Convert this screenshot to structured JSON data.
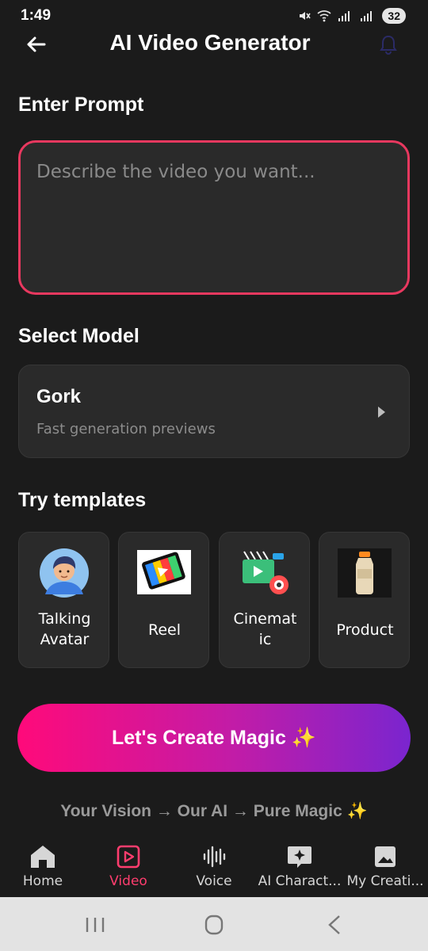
{
  "status": {
    "time": "1:49",
    "battery": "32"
  },
  "header": {
    "title": "AI Video Generator"
  },
  "prompt": {
    "section_title": "Enter Prompt",
    "placeholder": "Describe the video you want..."
  },
  "model": {
    "section_title": "Select Model",
    "name": "Gork",
    "description": "Fast generation previews"
  },
  "templates": {
    "section_title": "Try templates",
    "items": [
      {
        "line1": "Talking",
        "line2": "Avatar",
        "icon": "avatar-icon"
      },
      {
        "line1": "Reel",
        "line2": "",
        "icon": "reel-icon"
      },
      {
        "line1": "Cinemat",
        "line2": "ic",
        "icon": "cinematic-icon"
      },
      {
        "line1": "Product",
        "line2": "",
        "icon": "product-icon"
      }
    ]
  },
  "cta": {
    "label": "Let's Create Magic ✨"
  },
  "tagline": "Your Vision → Our AI → Pure Magic ✨",
  "nav": {
    "items": [
      {
        "label": "Home",
        "icon": "home-icon"
      },
      {
        "label": "Video",
        "icon": "video-icon"
      },
      {
        "label": "Voice",
        "icon": "voice-icon"
      },
      {
        "label": "AI Charact...",
        "icon": "ai-character-icon"
      },
      {
        "label": "My Creati...",
        "icon": "my-creations-icon"
      }
    ],
    "active": "Video"
  },
  "colors": {
    "accent": "#e8385f",
    "active_nav": "#ff3d6e",
    "gradient_start": "#ff0a7a",
    "gradient_end": "#7a25cf"
  }
}
